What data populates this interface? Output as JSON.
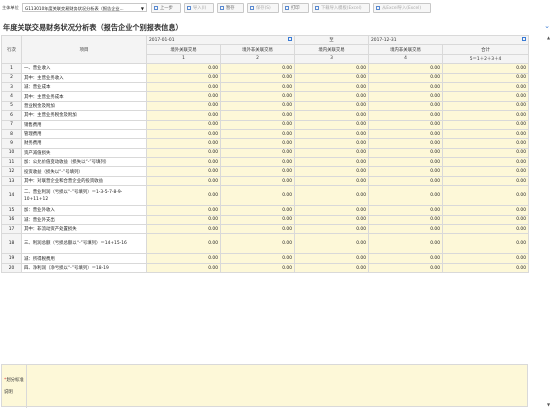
{
  "toolbar": {
    "entity_label": "主体单位",
    "entity_value": "G113010年度关联交易财务状况分析表（报告企业...",
    "buttons": [
      {
        "label": "上一步",
        "enabled": true
      },
      {
        "label": "导入(I)",
        "enabled": false
      },
      {
        "label": "暂存",
        "enabled": true
      },
      {
        "label": "保存(S)",
        "enabled": false
      },
      {
        "label": "打印",
        "enabled": true
      },
      {
        "label": "下载导入模板(Excel)",
        "enabled": false
      },
      {
        "label": "从Excel导入(Excel)",
        "enabled": false
      }
    ]
  },
  "title": "年度关联交易财务状况分析表（报告企业个别报表信息）",
  "header": {
    "row_no": "行次",
    "item": "项目",
    "start_date": "2017-01-01",
    "to": "至",
    "end_date": "2017-12-31",
    "cols": [
      "境外关联交易",
      "境外非关联交易",
      "境内关联交易",
      "境内非关联交易",
      "合计"
    ],
    "col_nums": [
      "1",
      "2",
      "3",
      "4",
      "5＝1＋2＋3＋4"
    ]
  },
  "rows": [
    {
      "no": "1",
      "label": "一、营业收入",
      "vals": [
        "0.00",
        "0.00",
        "0.00",
        "0.00",
        "0.00"
      ]
    },
    {
      "no": "2",
      "label": "其中：主营业务收入",
      "vals": [
        "0.00",
        "0.00",
        "0.00",
        "0.00",
        "0.00"
      ]
    },
    {
      "no": "3",
      "label": "减：营业成本",
      "vals": [
        "0.00",
        "0.00",
        "0.00",
        "0.00",
        "0.00"
      ]
    },
    {
      "no": "4",
      "label": "其中：主营业务成本",
      "vals": [
        "0.00",
        "0.00",
        "0.00",
        "0.00",
        "0.00"
      ]
    },
    {
      "no": "5",
      "label": "营业税金及附加",
      "vals": [
        "0.00",
        "0.00",
        "0.00",
        "0.00",
        "0.00"
      ]
    },
    {
      "no": "6",
      "label": "其中：主营业务税金及附加",
      "vals": [
        "0.00",
        "0.00",
        "0.00",
        "0.00",
        "0.00"
      ]
    },
    {
      "no": "7",
      "label": "销售费用",
      "vals": [
        "0.00",
        "0.00",
        "0.00",
        "0.00",
        "0.00"
      ]
    },
    {
      "no": "8",
      "label": "管理费用",
      "vals": [
        "0.00",
        "0.00",
        "0.00",
        "0.00",
        "0.00"
      ]
    },
    {
      "no": "9",
      "label": "财务费用",
      "vals": [
        "0.00",
        "0.00",
        "0.00",
        "0.00",
        "0.00"
      ]
    },
    {
      "no": "10",
      "label": "资产减值损失",
      "vals": [
        "0.00",
        "0.00",
        "0.00",
        "0.00",
        "0.00"
      ]
    },
    {
      "no": "11",
      "label": "加：公允价值变动收益（损失以“-”号填列）",
      "vals": [
        "0.00",
        "0.00",
        "0.00",
        "0.00",
        "0.00"
      ]
    },
    {
      "no": "12",
      "label": "投资收益（损失以“-”号填列）",
      "vals": [
        "0.00",
        "0.00",
        "0.00",
        "0.00",
        "0.00"
      ]
    },
    {
      "no": "13",
      "label": "其中：对联营企业和合营企业的投资收益",
      "vals": [
        "0.00",
        "0.00",
        "0.00",
        "0.00",
        "0.00"
      ]
    },
    {
      "no": "14",
      "label": "二、营业利润（亏损以“-”号填列）＝1-3-5-7-8-9-10+11+12",
      "vals": [
        "0.00",
        "0.00",
        "0.00",
        "0.00",
        "0.00"
      ],
      "tall": true
    },
    {
      "no": "15",
      "label": "加：营业外收入",
      "vals": [
        "0.00",
        "0.00",
        "0.00",
        "0.00",
        "0.00"
      ]
    },
    {
      "no": "16",
      "label": "减：营业外支出",
      "vals": [
        "0.00",
        "0.00",
        "0.00",
        "0.00",
        "0.00"
      ]
    },
    {
      "no": "17",
      "label": "其中：非流动资产处置损失",
      "vals": [
        "0.00",
        "0.00",
        "0.00",
        "0.00",
        "0.00"
      ]
    },
    {
      "no": "18",
      "label": "三、利润总额（亏损总额以“-”号填列）＝14+15-16",
      "vals": [
        "0.00",
        "0.00",
        "0.00",
        "0.00",
        "0.00"
      ],
      "tall": true
    },
    {
      "no": "19",
      "label": "减：所得税费用",
      "vals": [
        "0.00",
        "0.00",
        "0.00",
        "0.00",
        "0.00"
      ]
    },
    {
      "no": "20",
      "label": "四、净利润（净亏损以“-”号填列）＝18-19",
      "vals": [
        "0.00",
        "0.00",
        "0.00",
        "0.00",
        "0.00"
      ]
    }
  ],
  "note": {
    "required_mark": "*",
    "label": "划分标准说明",
    "value": ""
  }
}
